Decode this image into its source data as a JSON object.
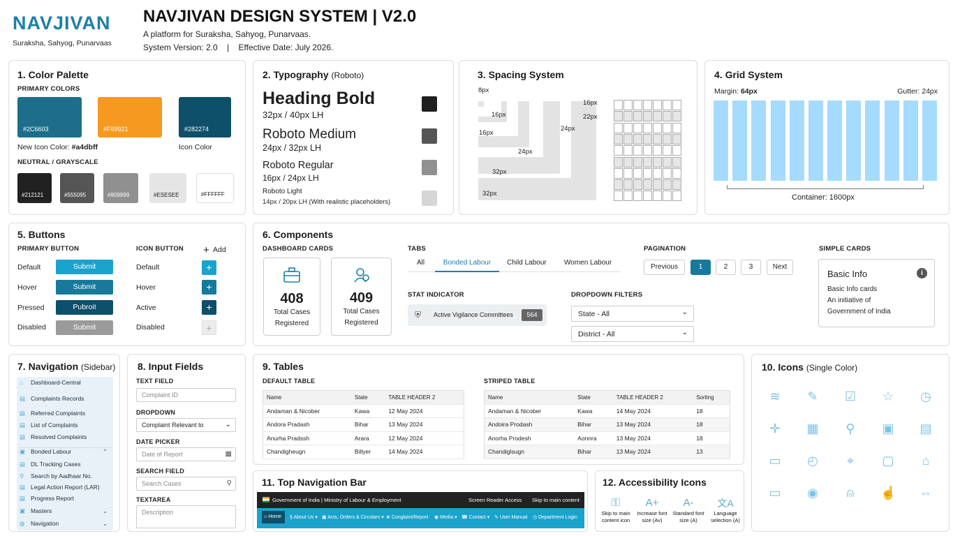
{
  "header": {
    "logo_text": "NAVJIVAN",
    "logo_tagline": "Suraksha, Sahyog, Punarvaas",
    "title": "NAVJIVAN DESIGN SYSTEM | V2.0",
    "subtitle": "A platform for Suraksha, Sahyog, Punarvaas.",
    "version_line": "System Version: 2.0    |    Effective Date: July 2026."
  },
  "color_palette": {
    "title": "1. Color Palette",
    "primary_label": "PRIMARY COLORS",
    "primary": [
      {
        "hex": "#2C6603",
        "color": "#1d6e8a"
      },
      {
        "hex": "#F69921",
        "color": "#f69921"
      },
      {
        "hex": "#282274",
        "color": "#0e4f6a"
      }
    ],
    "new_icon_label": "New Icon Color: ",
    "new_icon_value": "#a4dbff",
    "icon_color_label": "Icon Color",
    "neutral_label": "NEUTRAL / GRAYSCALE",
    "neutral": [
      {
        "hex": "#212121",
        "color": "#212121",
        "text": "#ffffff"
      },
      {
        "hex": "#555095",
        "color": "#555555",
        "text": "#ffffff"
      },
      {
        "hex": "#909999",
        "color": "#909090",
        "text": "#ffffff"
      },
      {
        "hex": "#ESESEE",
        "color": "#e5e5e5",
        "text": "#222222"
      },
      {
        "hex": "#FFFFFF",
        "color": "#ffffff",
        "text": "#222222"
      }
    ]
  },
  "typography": {
    "title": "2. Typography",
    "title_note": "(Roboto)",
    "styles": [
      {
        "name": "Heading Bold",
        "spec": "32px / 40px LH",
        "color": "#1f1f1f"
      },
      {
        "name": "Roboto Medium",
        "spec": "24px / 32px LH",
        "color": "#555555"
      },
      {
        "name": "Roboto Regular",
        "spec": "16px / 24px LH",
        "color": "#909090"
      },
      {
        "name": "Roboto Light",
        "spec": "14px / 20px LH (With realistic placeholders)",
        "color": "#d6d6d6"
      }
    ]
  },
  "spacing": {
    "title": "3. Spacing System",
    "labels": [
      "8px",
      "16px",
      "16px",
      "24px",
      "32px",
      "32px",
      "16px",
      "22px",
      "24px"
    ]
  },
  "grid": {
    "title": "4. Grid System",
    "margin_label": "Margin: ",
    "margin_value": "64px",
    "gutter": "Gutter: 24px",
    "container": "Container: 1600px",
    "column_count": 12,
    "column_color": "#a4dbff"
  },
  "buttons": {
    "title": "5. Buttons",
    "primary_label": "PRIMARY BUTTON",
    "icon_label": "ICON BUTTON",
    "add_label": "Add",
    "states": [
      {
        "state": "Default",
        "label": "Submit",
        "color": "#1aa3cc"
      },
      {
        "state": "Hover",
        "label": "Submit",
        "color": "#177a9c"
      },
      {
        "state": "Pressed",
        "label": "Pubroit",
        "color": "#0e4f6a"
      },
      {
        "state": "Disabled",
        "label": "Submit",
        "color": "#9a9a9a"
      }
    ],
    "icon_states": [
      {
        "state": "Default",
        "color": "#1aa3cc"
      },
      {
        "state": "Hover",
        "color": "#177a9c"
      },
      {
        "state": "Active",
        "color": "#0e4f6a"
      },
      {
        "state": "Disabled",
        "color": "#e6e6e6"
      }
    ]
  },
  "components": {
    "title": "6. Components",
    "dash_label": "DASHBOARD CARDS",
    "dash_cards": [
      {
        "value": "408",
        "label": "Total Cases Registered"
      },
      {
        "value": "409",
        "label": "Total Cases Registered"
      }
    ],
    "tabs_label": "TABS",
    "tabs": [
      "All",
      "Bonded Labour",
      "Child Labour",
      "Women Labour"
    ],
    "active_tab": "Bonded Labour",
    "stat_label": "STAT INDICATOR",
    "stat_text": "Active Vigilance Committees",
    "stat_value": "564",
    "dropdown_label": "DROPDOWN FILTERS",
    "dropdowns": [
      "State - All",
      "District - All"
    ],
    "pagination_label": "PAGINATION",
    "pagination": [
      "Previous",
      "1",
      "2",
      "3",
      "Next"
    ],
    "active_page": "1",
    "simple_label": "SIMPLE CARDS",
    "simple_title": "Basic Info",
    "simple_body": [
      "Basic Info cards",
      "An initiative of",
      "Government of India"
    ]
  },
  "navigation": {
    "title": "7. Navigation",
    "title_note": "(Sidebar)",
    "items": [
      "Dashboard-Central",
      "Complaints Records",
      "Referred Complaints",
      "List of Complaints",
      "Resolved Complaints",
      "Bonded Labour",
      "DL Tracking Cases",
      "Search by Aadhaar No.",
      "Legal Action Report (LAR)",
      "Progress Report",
      "Masters",
      "Navigation"
    ]
  },
  "inputs": {
    "title": "8. Input Fields",
    "text_label": "TEXT FIELD",
    "text_placeholder": "Complaint ID",
    "dropdown_label": "DROPDOWN",
    "dropdown_value": "Complaint Relevant to",
    "date_label": "DATE PICKER",
    "date_placeholder": "Date of Report",
    "search_label": "SEARCH FIELD",
    "search_placeholder": "Search Cases",
    "textarea_label": "TEXTAREA",
    "textarea_placeholder": "Description"
  },
  "tables": {
    "title": "9. Tables",
    "default_label": "DEFAULT TABLE",
    "default_headers": [
      "Name",
      "State",
      "TABLE HEADER 2"
    ],
    "default_rows": [
      [
        "Andaman & Nicober",
        "Kawa",
        "12 May 2024"
      ],
      [
        "Andora Pradash",
        "Bihar",
        "13 May 2024"
      ],
      [
        "Anurha Pradssh",
        "Arara",
        "12 May 2024"
      ],
      [
        "Chandigheugn",
        "Billyer",
        "14 May 2024"
      ]
    ],
    "striped_label": "STRIPED TABLE",
    "striped_headers": [
      "Name",
      "State",
      "TABLE HEADER 2",
      "Sorting"
    ],
    "striped_rows": [
      [
        "Andaman & Nicober",
        "Kawa",
        "14 May 2024",
        "18"
      ],
      [
        "Andoira Prodash",
        "Bihar",
        "13 May 2024",
        "18"
      ],
      [
        "Anorha Prodesh",
        "Aonnra",
        "13 May 2024",
        "18"
      ],
      [
        "Chandiglsugn",
        "Bihar",
        "13 May 2024",
        "13"
      ]
    ]
  },
  "icons": {
    "title": "10. Icons",
    "title_note": "(Single Color)",
    "names": [
      "layers-icon",
      "document-edit-icon",
      "checklist-icon",
      "star-icon",
      "clock-icon",
      "plus-icon",
      "calendar-icon",
      "location-pin-icon",
      "id-card-icon",
      "calculator-icon",
      "file-icon",
      "time-icon",
      "map-pin-icon",
      "chat-icon",
      "home-user-icon",
      "briefcase-icon",
      "camera-badge-icon",
      "user-icon",
      "hand-pointer-icon",
      "swap-icon"
    ]
  },
  "topnav": {
    "title": "11. Top Navigation Bar",
    "gov_text": "Government of India | Ministry of Labour & Employment",
    "screen_reader": "Screen Reader Access",
    "skip": "Skip to main content",
    "menu": [
      "Home",
      "About Us ▾",
      "Acts, Orders & Circolars ▾",
      "Conglaint/Report",
      "Media ▾",
      "Contact ▾",
      "User Manual",
      "Department Login"
    ]
  },
  "accessibility": {
    "title": "12. Accessibility Icons",
    "items": [
      {
        "glyph": "⚿",
        "label": "Skip to main content icon"
      },
      {
        "glyph": "A+",
        "label": "Increase font size (Av)"
      },
      {
        "glyph": "A-",
        "label": "Standard font size (A)"
      },
      {
        "glyph": "文A",
        "label": "Language selection (A)"
      }
    ]
  }
}
